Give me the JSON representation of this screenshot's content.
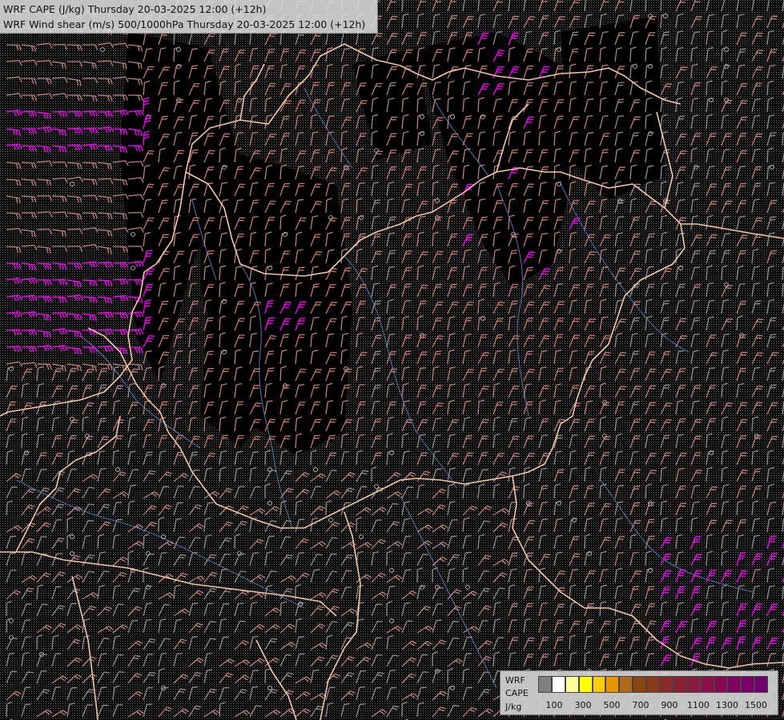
{
  "title": {
    "line1": "WRF CAPE (J/kg) Thursday 20-03-2025 12:00 (+12h)",
    "line2": "WRF Wind shear (m/s) 500/1000hPa Thursday 20-03-2025 12:00 (+12h)"
  },
  "legend": {
    "label_top": "WRF",
    "label_mid": "CAPE",
    "label_unit": "J/kg",
    "swatches": [
      "#808080",
      "#ffffff",
      "#ffff99",
      "#ffff00",
      "#ffcc00",
      "#e69500",
      "#b06a1a",
      "#8b4513",
      "#8b3a1a",
      "#8b2a2a",
      "#8b2035",
      "#8b1a40",
      "#8b104a",
      "#880855",
      "#800060",
      "#780068",
      "#700070"
    ],
    "ticks": [
      "100",
      "300",
      "500",
      "700",
      "900",
      "1100",
      "1300",
      "1500"
    ]
  },
  "map": {
    "background": "#000000",
    "stipple_color": "#777777",
    "border_color": "#f2c8a0",
    "river_color": "#4a6fa8",
    "barb_colors": {
      "weak": "#9a8c8c",
      "moderate": "#c08080",
      "strong": "#c87870",
      "extreme": "#ff00ff",
      "calm_circle": "#cfcfcf"
    }
  }
}
